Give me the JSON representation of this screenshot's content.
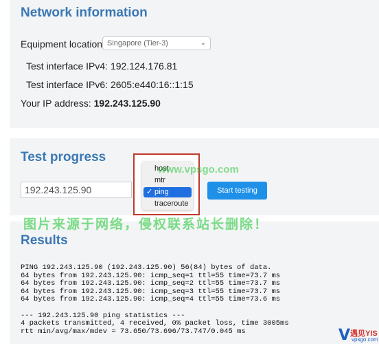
{
  "network": {
    "title": "Network information",
    "location_label": "Equipment location:",
    "location_value": "Singapore (Tier-3)",
    "ipv4_label": "Test interface IPv4:",
    "ipv4_value": "192.124.176.81",
    "ipv6_label": "Test interface IPv6:",
    "ipv6_value": "2605:e440:16::1:15",
    "your_ip_label": "Your IP address:",
    "your_ip_value": "192.243.125.90"
  },
  "progress": {
    "title": "Test progress",
    "ip_input_value": "192.243.125.90",
    "method_options": [
      {
        "label": "host",
        "selected": false
      },
      {
        "label": "mtr",
        "selected": false
      },
      {
        "label": "ping",
        "selected": true
      },
      {
        "label": "traceroute",
        "selected": false
      }
    ],
    "selected_mark": "✓",
    "start_label": "Start testing"
  },
  "results": {
    "title": "Results",
    "output": "PING 192.243.125.90 (192.243.125.90) 56(84) bytes of data.\n64 bytes from 192.243.125.90: icmp_seq=1 ttl=55 time=73.7 ms\n64 bytes from 192.243.125.90: icmp_seq=2 ttl=55 time=73.7 ms\n64 bytes from 192.243.125.90: icmp_seq=3 ttl=55 time=73.7 ms\n64 bytes from 192.243.125.90: icmp_seq=4 ttl=55 time=73.6 ms\n\n--- 192.243.125.90 ping statistics ---\n4 packets transmitted, 4 received, 0% packet loss, time 3005ms\nrtt min/avg/max/mdev = 73.650/73.696/73.747/0.045 ms"
  },
  "watermark": {
    "url": "www.vpsgo.com",
    "notice": "图片来源于网络，侵权联系站长删除！",
    "logo_letter": "V",
    "logo_cn": "遇见YIS",
    "logo_en": "vpsgo.com"
  },
  "colors": {
    "title_blue": "#3a78b5",
    "button_blue": "#1e90e8",
    "highlight_red": "#c0392b",
    "selected_option": "#1f6fe0"
  }
}
